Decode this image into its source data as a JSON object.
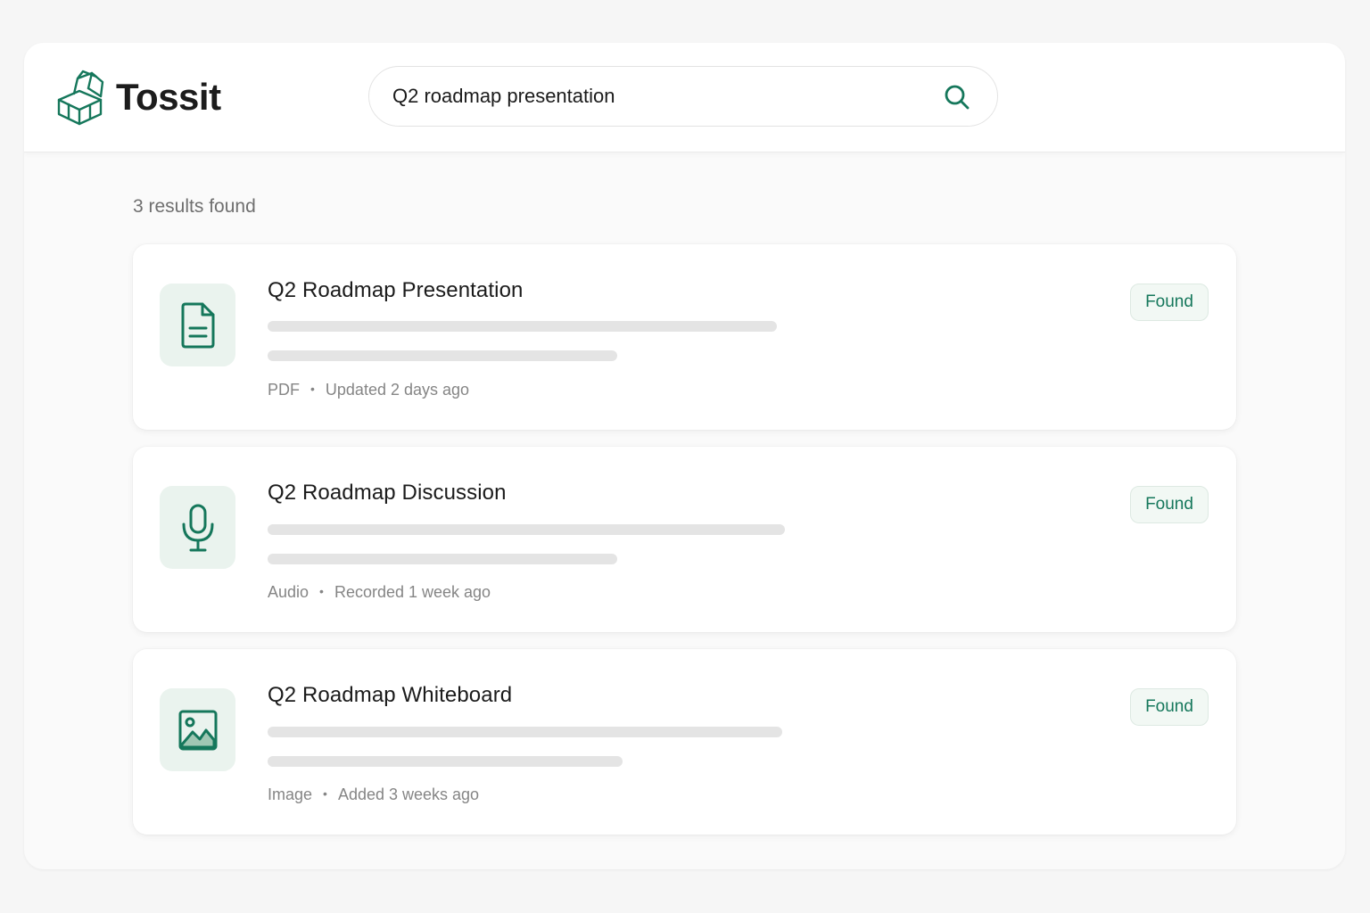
{
  "brand": {
    "name": "Tossit",
    "logo_icon": "open-box-icon"
  },
  "search": {
    "value": "Q2 roadmap presentation",
    "icon": "search-icon"
  },
  "results": {
    "count_label": "3 results found",
    "items": [
      {
        "title": "Q2 Roadmap Presentation",
        "type": "PDF",
        "time": "Updated 2 days ago",
        "badge": "Found",
        "icon": "document-icon"
      },
      {
        "title": "Q2 Roadmap Discussion",
        "type": "Audio",
        "time": "Recorded 1 week ago",
        "badge": "Found",
        "icon": "microphone-icon"
      },
      {
        "title": "Q2 Roadmap Whiteboard",
        "type": "Image",
        "time": "Added 3 weeks ago",
        "badge": "Found",
        "icon": "image-icon"
      }
    ]
  },
  "colors": {
    "accent": "#15775b",
    "icon_bg": "#eaf3ee",
    "badge_bg": "#f2f8f4",
    "skeleton": "#e4e4e4"
  }
}
